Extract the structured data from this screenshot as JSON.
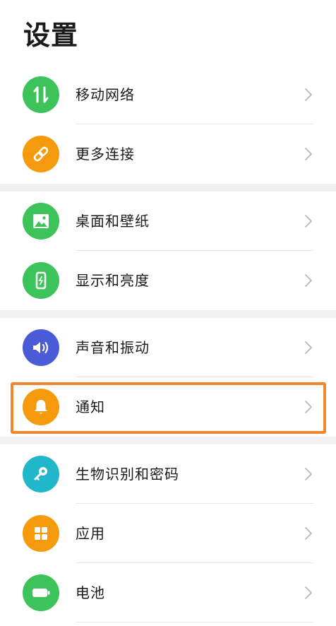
{
  "header": {
    "title": "设置"
  },
  "colors": {
    "green": "#3cc45a",
    "orange": "#f59a0c",
    "blue": "#4a5bd8",
    "teal": "#1fb7c9",
    "highlight": "#f0872f",
    "chevron": "#b8b8b8",
    "separator": "#f1f1f1"
  },
  "groups": [
    {
      "items": [
        {
          "label": "移动网络",
          "icon": "mobile-data-icon",
          "color": "green"
        },
        {
          "label": "更多连接",
          "icon": "link-icon",
          "color": "orange"
        }
      ]
    },
    {
      "items": [
        {
          "label": "桌面和壁纸",
          "icon": "wallpaper-icon",
          "color": "green"
        },
        {
          "label": "显示和亮度",
          "icon": "display-icon",
          "color": "green"
        }
      ]
    },
    {
      "items": [
        {
          "label": "声音和振动",
          "icon": "speaker-icon",
          "color": "blue"
        },
        {
          "label": "通知",
          "icon": "bell-icon",
          "color": "orange",
          "highlighted": true
        }
      ]
    },
    {
      "items": [
        {
          "label": "生物识别和密码",
          "icon": "key-icon",
          "color": "teal"
        },
        {
          "label": "应用",
          "icon": "apps-grid-icon",
          "color": "orange"
        },
        {
          "label": "电池",
          "icon": "battery-icon",
          "color": "green"
        }
      ]
    }
  ]
}
